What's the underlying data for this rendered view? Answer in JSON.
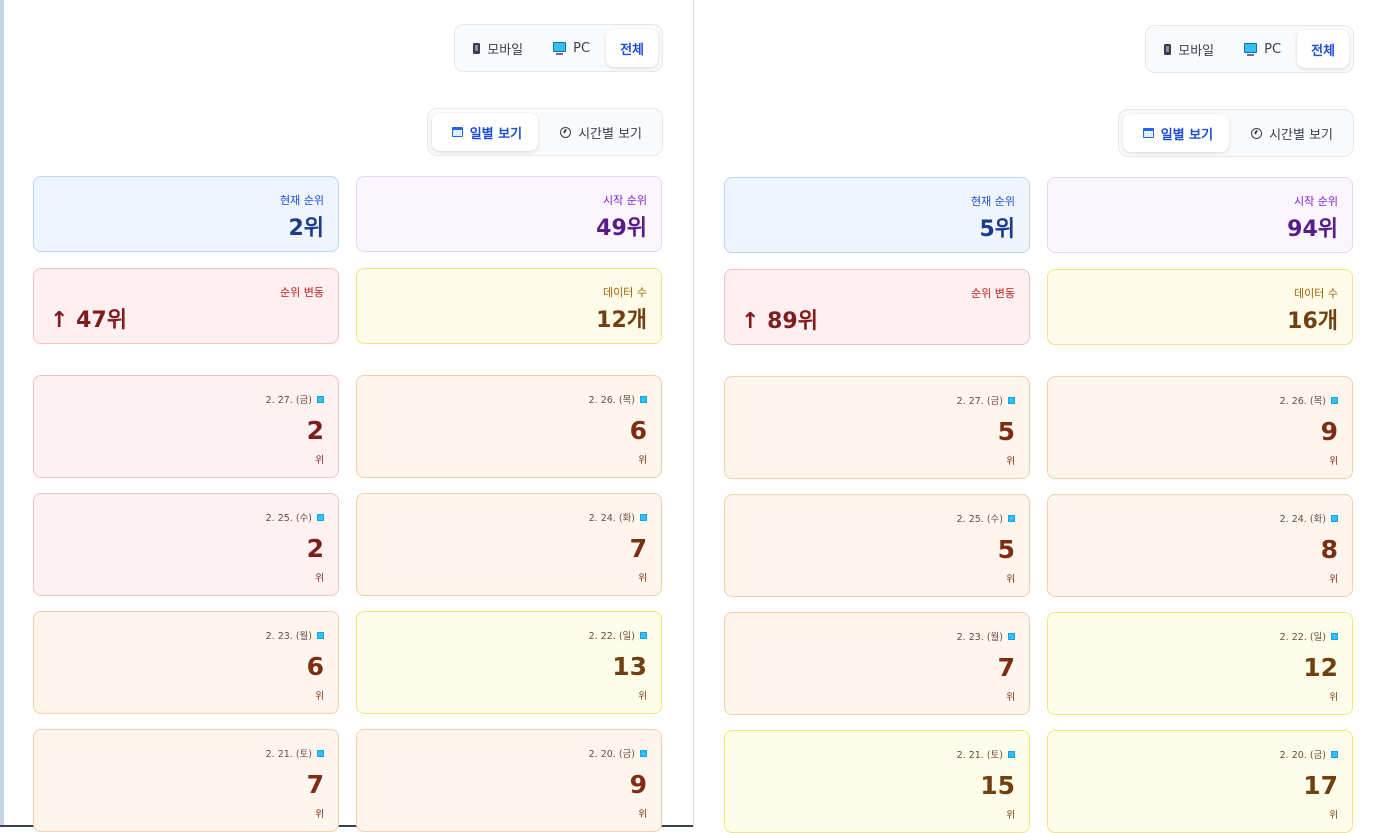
{
  "panels": [
    {
      "device_tabs": [
        {
          "label": "모바일",
          "icon": "mobile-icon",
          "active": false
        },
        {
          "label": "PC",
          "icon": "pc-icon",
          "active": false
        },
        {
          "label": "전체",
          "icon": "",
          "active": true
        }
      ],
      "view_tabs": [
        {
          "label": "일별 보기",
          "icon": "calendar-icon",
          "active": true
        },
        {
          "label": "시간별 보기",
          "icon": "clock-icon",
          "active": false
        }
      ],
      "stats": {
        "current_rank": {
          "label": "현재 순위",
          "value": "2위"
        },
        "start_rank": {
          "label": "시작 순위",
          "value": "49위"
        },
        "rank_change": {
          "label": "순위 변동",
          "value": "↑ 47위"
        },
        "data_count": {
          "label": "데이터 수",
          "value": "12개"
        }
      },
      "days": [
        {
          "date": "2. 27. (금)",
          "rank": "2",
          "unit": "위",
          "tone": "red"
        },
        {
          "date": "2. 26. (목)",
          "rank": "6",
          "unit": "위",
          "tone": "orange"
        },
        {
          "date": "2. 25. (수)",
          "rank": "2",
          "unit": "위",
          "tone": "red"
        },
        {
          "date": "2. 24. (화)",
          "rank": "7",
          "unit": "위",
          "tone": "orange"
        },
        {
          "date": "2. 23. (월)",
          "rank": "6",
          "unit": "위",
          "tone": "orange"
        },
        {
          "date": "2. 22. (일)",
          "rank": "13",
          "unit": "위",
          "tone": "yellow"
        },
        {
          "date": "2. 21. (토)",
          "rank": "7",
          "unit": "위",
          "tone": "orange"
        },
        {
          "date": "2. 20. (금)",
          "rank": "9",
          "unit": "위",
          "tone": "orange"
        }
      ]
    },
    {
      "device_tabs": [
        {
          "label": "모바일",
          "icon": "mobile-icon",
          "active": false
        },
        {
          "label": "PC",
          "icon": "pc-icon",
          "active": false
        },
        {
          "label": "전체",
          "icon": "",
          "active": true
        }
      ],
      "view_tabs": [
        {
          "label": "일별 보기",
          "icon": "calendar-icon",
          "active": true
        },
        {
          "label": "시간별 보기",
          "icon": "clock-icon",
          "active": false
        }
      ],
      "stats": {
        "current_rank": {
          "label": "현재 순위",
          "value": "5위"
        },
        "start_rank": {
          "label": "시작 순위",
          "value": "94위"
        },
        "rank_change": {
          "label": "순위 변동",
          "value": "↑ 89위"
        },
        "data_count": {
          "label": "데이터 수",
          "value": "16개"
        }
      },
      "days": [
        {
          "date": "2. 27. (금)",
          "rank": "5",
          "unit": "위",
          "tone": "orange"
        },
        {
          "date": "2. 26. (목)",
          "rank": "9",
          "unit": "위",
          "tone": "orange"
        },
        {
          "date": "2. 25. (수)",
          "rank": "5",
          "unit": "위",
          "tone": "orange"
        },
        {
          "date": "2. 24. (화)",
          "rank": "8",
          "unit": "위",
          "tone": "orange"
        },
        {
          "date": "2. 23. (월)",
          "rank": "7",
          "unit": "위",
          "tone": "orange"
        },
        {
          "date": "2. 22. (일)",
          "rank": "12",
          "unit": "위",
          "tone": "yellow"
        },
        {
          "date": "2. 21. (토)",
          "rank": "15",
          "unit": "위",
          "tone": "yellow"
        },
        {
          "date": "2. 20. (금)",
          "rank": "17",
          "unit": "위",
          "tone": "yellow"
        }
      ]
    }
  ]
}
